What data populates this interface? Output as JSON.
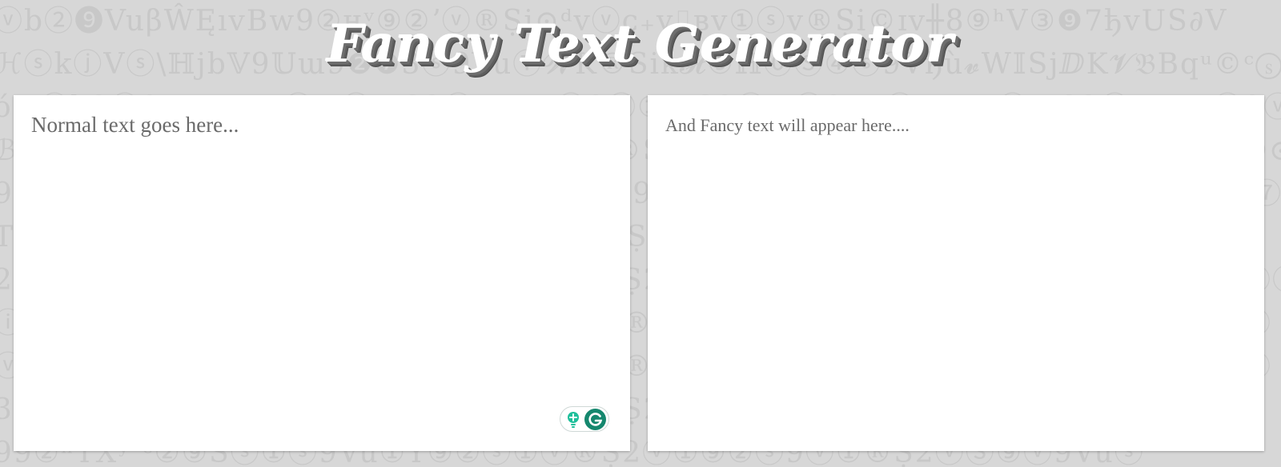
{
  "background": {
    "rows": [
      "ⓥb②❾VuβŴĘıvBw9②ʜᵛ⑨②ʼⓥ®Ṣi⊙ᵈvⓥᴄ₊ᴠ⌷ʙv①ⓢv®Ṣi©ɪv╫8⑨ʰV③❾7ђvUS∂V",
      "ℋⓢkⓙVⓢ\\ℍjb𝕍9𝕌ɯ9❷❼3ⓢ9VuⓉ𝓦K®Sik𝓗⑨ℍ⓪Ⓢ④ⓢ9Vђù𝓿W𝕀SjⅅK𝓥𝔅Bqᵘ©ᶜⓢ",
      "ó①ⓥb2ⓥ9Vu①⑨②ⓢ①ⓥ®Ṣ2ⓥ①⑨②ⓢ9ⓥ①®Ṣ2ⓥ⑨ⓥ9Vuⓢ①⑨②ⓥ®Ṣ2ⓥ①⑨②ⓢ9ⓥ",
      "ℬ2ⓢ9Vu①⑨②ⓢ①ⓥ®Ṣℎ2ⓥ①⑨②ⓢ9ⓥ①®Ṣ2ⓥ⑨ⓥ9Vuⓢ①⑨②ⓥ®Ṣ2ⓥ①⑨②ⓢ9ⓥ①⊙",
      "9ⓥ①⑨②ⓢ9Vu①⑨②ⓢ①ⓥ®Ṣ2ⓥ①⑨②ⓢ9ⓥ①®Ṣ2ⓥ⑨ⓥ9Vuⓢ①⑨②ⓥ®Ṣ2ⓥ①⑨⑦",
      "Ƭ②ⓢ9Vu①⑨②ⓢ①ⓥ®Ṣ2ⓥ①⑨②ⓢ9ⓥ①®Ṣ2ⓥ⑨ⓥ9Vuⓢ①⑨②ⓥ®Ṣ2ⓥ①⑨②ⓢ9ⓥ",
      "2ⓥ9Vu①⑨②ⓢ①ⓥ®Ṣ2ⓥ①⑨②ⓢ9ⓥ①®Ṣ2ⓥ⑨ⓥ9Vuⓢ①⑨②ⓥ®Ṣ2ⓥ①⑨②ⓢ9ⓥ①ⓡ",
      "ⓘ2ⓢ9Vu①⑨②ⓢ①ⓥ®Ṣ2ⓥ①⑨②ⓢ9ⓥ①®Ṣ2ⓥ⑨ⓥ9Vuⓢ①⑨②ⓥ®Ṣ2ⓥ①⑨②ⓢ9ⓥ",
      "ⓥ2ⓢ9Vu①⑨②ⓢ①ⓥ®Ṣ2ⓥ①⑨②ⓢ9ⓥ①®Ṣ2ⓥ⑨ⓥ9Vuⓢ①⑨②ⓥ®Ṣ2ⓥ①⑨②ⓢ9ⓥ",
      "3ⓥ9Vu①⑨②ⓢ①ⓥ®Ṣ2ⓥ①⑨②ⓢ9ⓥ①®Ṣ2ⓥ⑨ⓥ9Vuⓢ①⑨②ⓥ®Ṣ2ⓥ①⑨②ⓢ9ⓥ",
      "99②ʰTXʸʼᶜ②⑨Sⓢ①ⓢ9Vu①Ŷ⑨②ⓢ①ⓥ®Ṣ2ⓥ①⑨②ⓢ9ⓥ①®Ṣ2ⓥⓈ⑨ⓥ9Vuⓢ"
    ]
  },
  "header": {
    "title": "Fancy Text Generator"
  },
  "input_panel": {
    "placeholder": "Normal text goes here...",
    "value": ""
  },
  "output_panel": {
    "text": "And Fancy text will appear here...."
  },
  "grammarly_widget": {
    "bulb_icon": "lightbulb-icon",
    "logo_icon": "grammarly-g-icon",
    "colors": {
      "primary": "#15876e",
      "bulb": "#1fbf9b"
    }
  }
}
